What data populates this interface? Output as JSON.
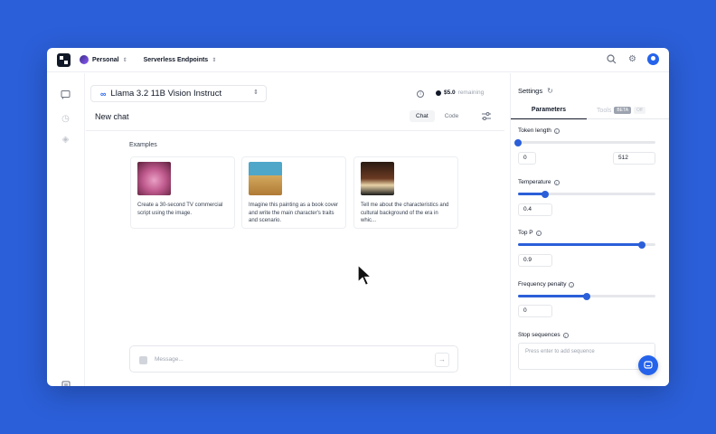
{
  "topbar": {
    "workspace": "Personal",
    "nav_item": "Serverless Endpoints",
    "icons": [
      "search-icon",
      "gear-icon",
      "user-avatar"
    ]
  },
  "main": {
    "model": "Llama 3.2 11B Vision Instruct",
    "credit_amount": "$5.0",
    "credit_label": "remaining",
    "chat_title": "New chat",
    "mode_tabs": [
      "Chat",
      "Code"
    ],
    "examples_label": "Examples",
    "examples": [
      {
        "text": "Create a 30-second TV commercial script using the image."
      },
      {
        "text": "Imagine this painting as a book cover and write the main character's traits and scenario."
      },
      {
        "text": "Tell me about the characteristics and cultural background of the era in whic..."
      }
    ],
    "message_placeholder": "Message..."
  },
  "settings": {
    "title": "Settings",
    "tabs": {
      "parameters": "Parameters",
      "tools": "Tools",
      "beta_badge": "BETA",
      "off_badge": "Off"
    },
    "token_length": {
      "label": "Token length",
      "min": "0",
      "max": "512",
      "value": 0
    },
    "temperature": {
      "label": "Temperature",
      "value": "0.4",
      "fraction": 0.2
    },
    "top_p": {
      "label": "Top P",
      "value": "0.9",
      "fraction": 0.9
    },
    "frequency_penalty": {
      "label": "Frequency penalty",
      "value": "0",
      "fraction": 0.5
    },
    "stop_sequences": {
      "label": "Stop sequences",
      "placeholder": "Press enter to add sequence"
    }
  },
  "colors": {
    "accent": "#2b5fd9",
    "background": "#2b5fd9"
  }
}
